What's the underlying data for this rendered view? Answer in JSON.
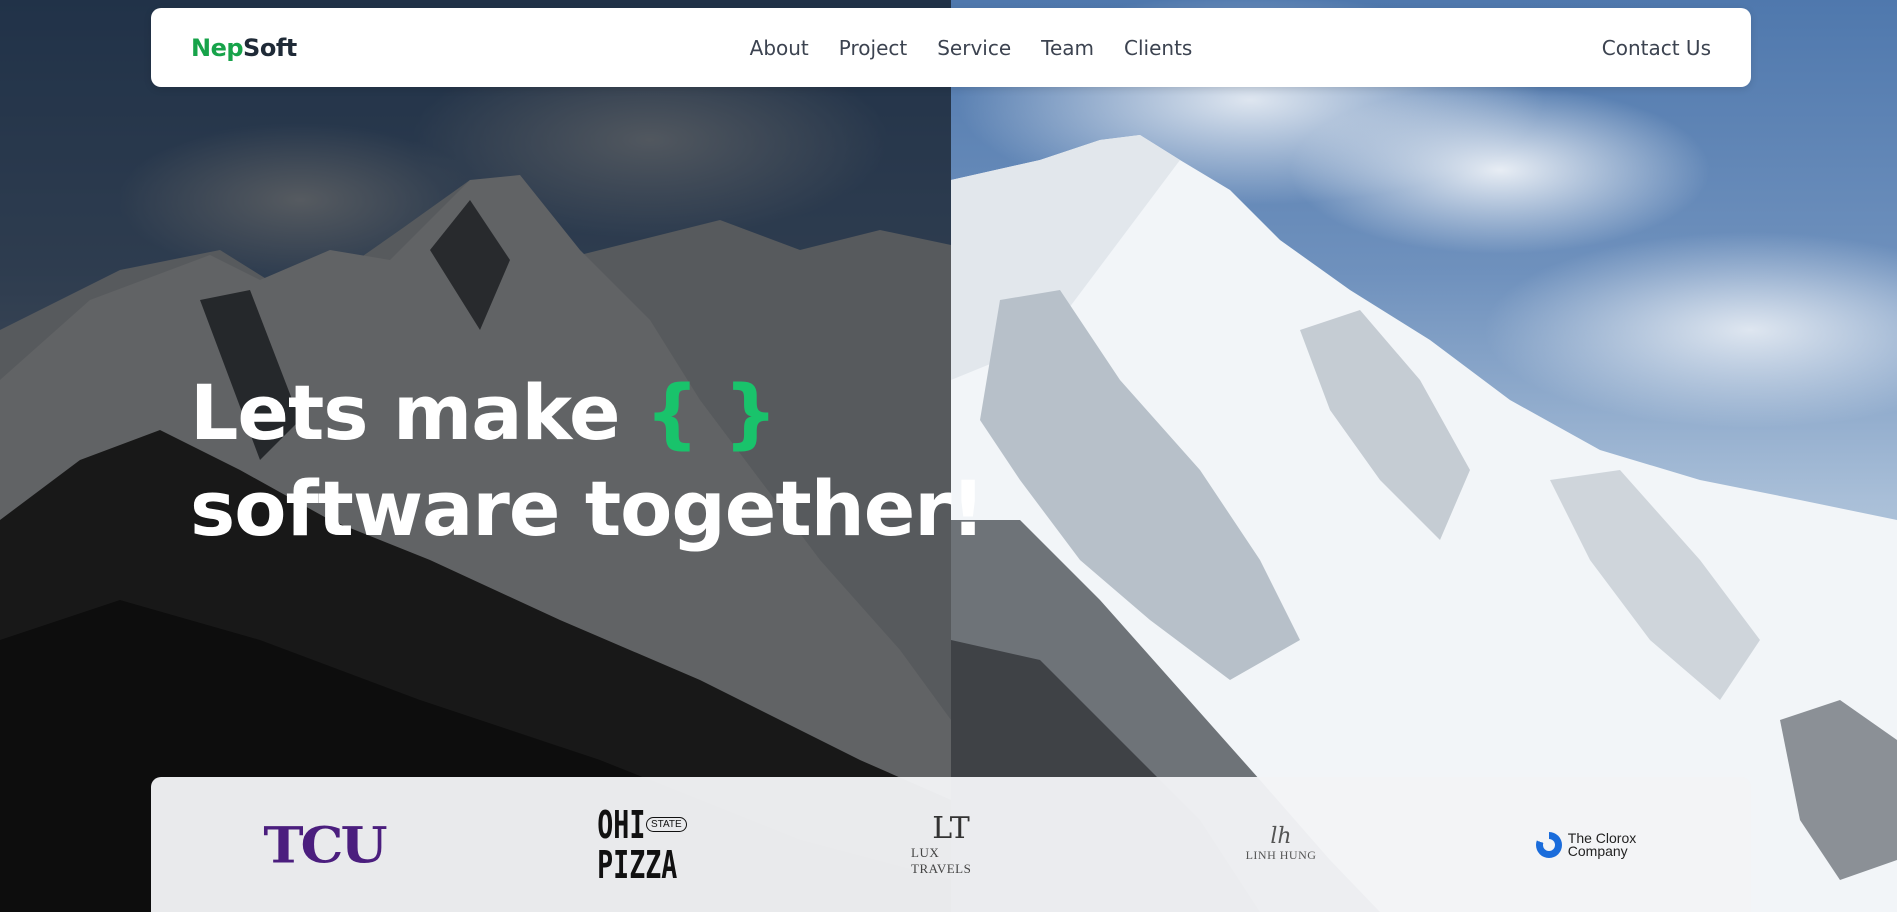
{
  "brand": {
    "part1": "Nep",
    "part2": "Soft"
  },
  "nav": {
    "links": [
      "About",
      "Project",
      "Service",
      "Team",
      "Clients"
    ],
    "contact": "Contact Us"
  },
  "hero": {
    "line1": "Lets make",
    "brace": "{ }",
    "line2": "software together!"
  },
  "clients": {
    "tcu": "TCU",
    "ohio_big_1": "OHI",
    "ohio_small": "STATE",
    "ohio_big_2": "PIZZA",
    "lux_mono": "LT",
    "lux_name": "LUX TRAVELS",
    "linh_script": "lh",
    "linh_name": "LINH HUNG",
    "clorox_line1": "The Clorox",
    "clorox_line2": "Company"
  },
  "colors": {
    "accent_green": "#17a34a",
    "brace_green": "#19c36b",
    "tcu_purple": "#4b1e7e",
    "clorox_blue": "#1a6cdb"
  }
}
